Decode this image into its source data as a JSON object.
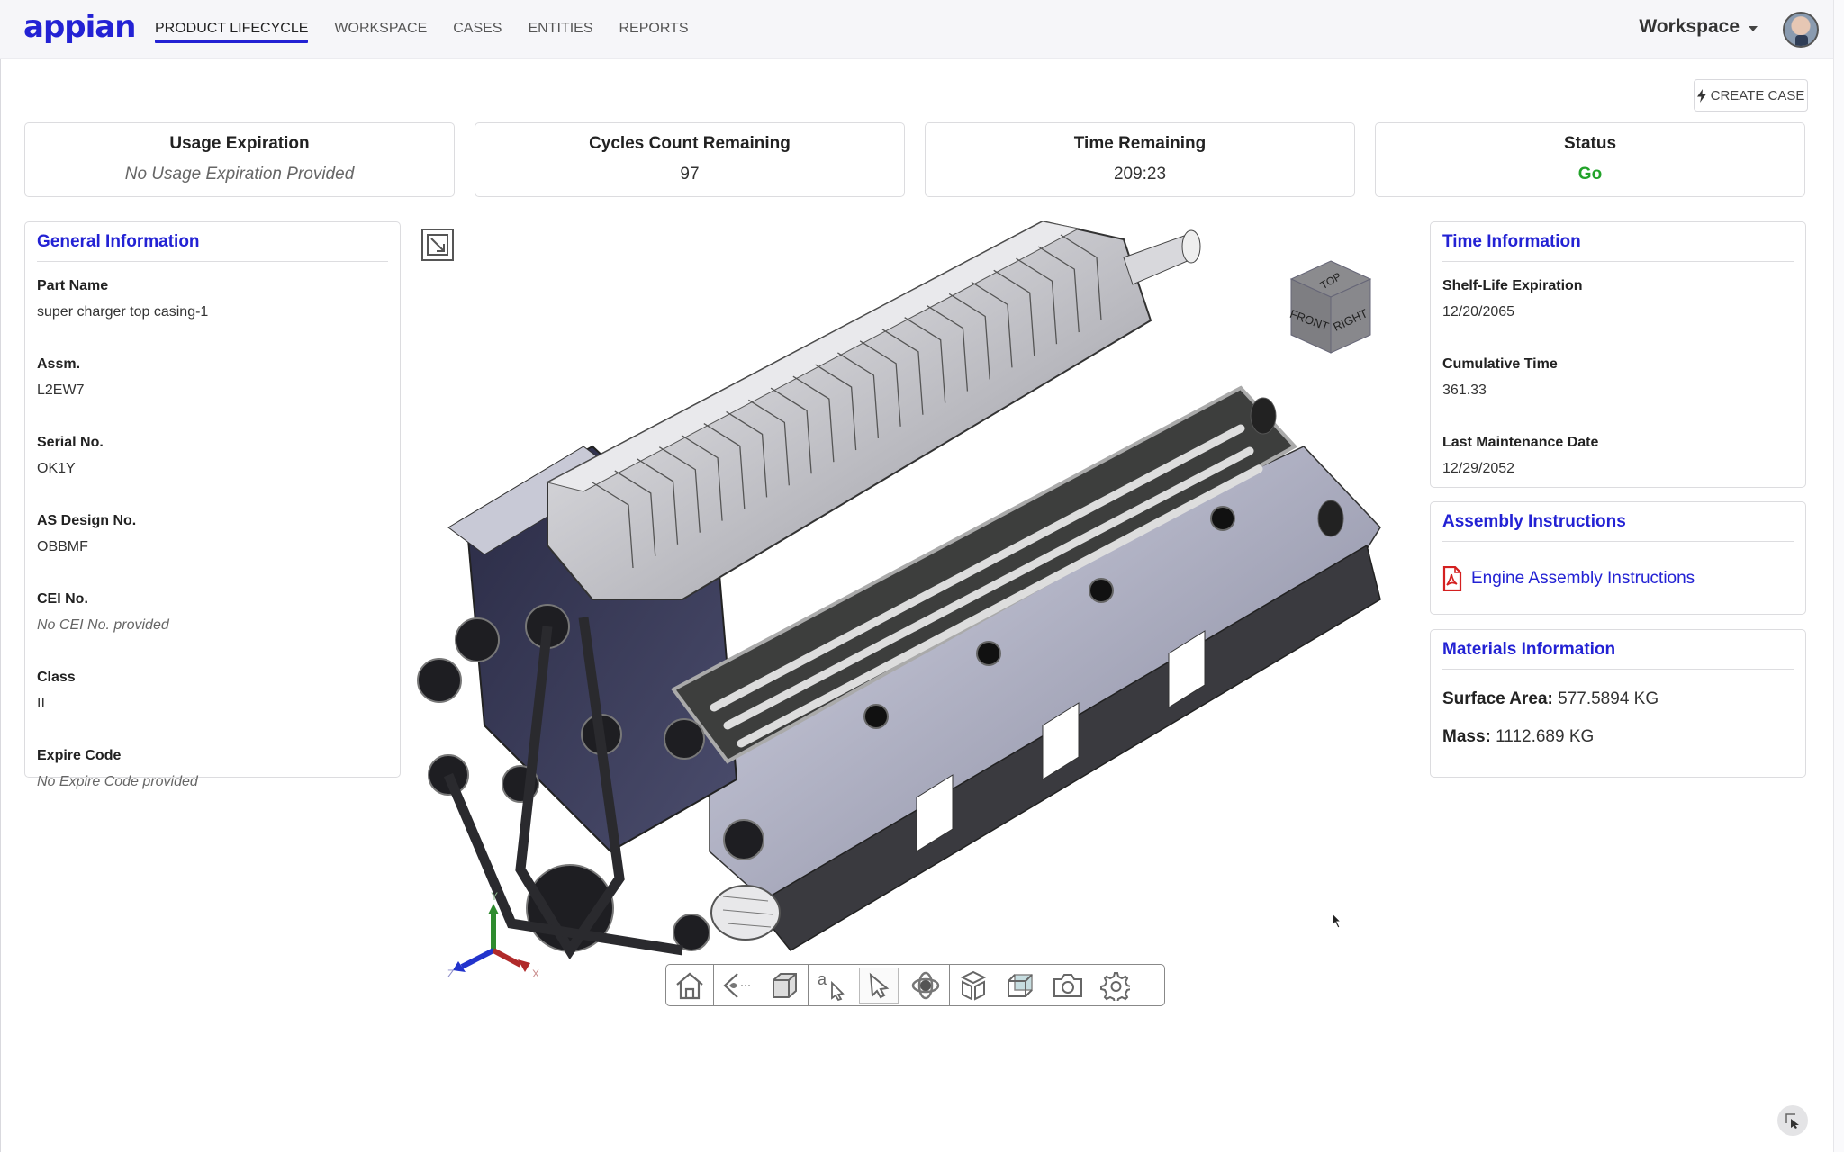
{
  "app": {
    "logo_text": "appian",
    "brand_color": "#2322d4"
  },
  "nav": {
    "items": [
      {
        "label": "PRODUCT LIFECYCLE",
        "active": true
      },
      {
        "label": "WORKSPACE",
        "active": false
      },
      {
        "label": "CASES",
        "active": false
      },
      {
        "label": "ENTITIES",
        "active": false
      },
      {
        "label": "REPORTS",
        "active": false
      }
    ],
    "workspace_menu": "Workspace",
    "avatar_icon": "user-avatar"
  },
  "actions": {
    "create_case_label": "CREATE CASE",
    "create_case_icon": "bolt-icon"
  },
  "kpis": [
    {
      "title": "Usage Expiration",
      "value": "No Usage Expiration Provided",
      "empty": true
    },
    {
      "title": "Cycles Count Remaining",
      "value": "97"
    },
    {
      "title": "Time Remaining",
      "value": "209:23"
    },
    {
      "title": "Status",
      "value": "Go",
      "color": "#22a32a"
    }
  ],
  "general_information": {
    "title": "General Information",
    "fields": [
      {
        "label": "Part Name",
        "value": "super charger top casing-1"
      },
      {
        "label": "Assm.",
        "value": "L2EW7"
      },
      {
        "label": "Serial No.",
        "value": "OK1Y"
      },
      {
        "label": "AS Design No.",
        "value": "OBBMF"
      },
      {
        "label": "CEI No.",
        "value": "No CEI No. provided",
        "empty": true
      },
      {
        "label": "Class",
        "value": "II"
      },
      {
        "label": "Expire Code",
        "value": "No Expire Code provided",
        "empty": true
      }
    ]
  },
  "time_information": {
    "title": "Time Information",
    "fields": [
      {
        "label": "Shelf-Life Expiration",
        "value": "12/20/2065"
      },
      {
        "label": "Cumulative Time",
        "value": "361.33"
      },
      {
        "label": "Last Maintenance Date",
        "value": "12/29/2052"
      }
    ]
  },
  "assembly_instructions": {
    "title": "Assembly Instructions",
    "document": {
      "label": "Engine Assembly Instructions",
      "icon": "pdf-icon"
    }
  },
  "materials_information": {
    "title": "Materials Information",
    "rows": [
      {
        "label": "Surface Area:",
        "value": "577.5894 KG"
      },
      {
        "label": "Mass:",
        "value": "1112.689 KG"
      }
    ]
  },
  "viewer": {
    "model_description": "supercharged V8 engine 3D model",
    "view_cube": {
      "top": "TOP",
      "front": "FRONT",
      "right": "RIGHT"
    },
    "axes": {
      "x": "X",
      "y": "Y",
      "z": "Z"
    },
    "toolbar": [
      {
        "group": 1,
        "icon": "home-icon"
      },
      {
        "group": 2,
        "icon": "eye-view-icon"
      },
      {
        "group": 2,
        "icon": "cube-view-icon"
      },
      {
        "group": 3,
        "icon": "annotation-select-icon"
      },
      {
        "group": 3,
        "icon": "select-pointer-icon",
        "selected": true
      },
      {
        "group": 3,
        "icon": "orbit-icon"
      },
      {
        "group": 4,
        "icon": "explode-icon"
      },
      {
        "group": 4,
        "icon": "section-box-icon"
      },
      {
        "group": 5,
        "icon": "camera-icon"
      },
      {
        "group": 5,
        "icon": "settings-gear-icon"
      }
    ]
  }
}
